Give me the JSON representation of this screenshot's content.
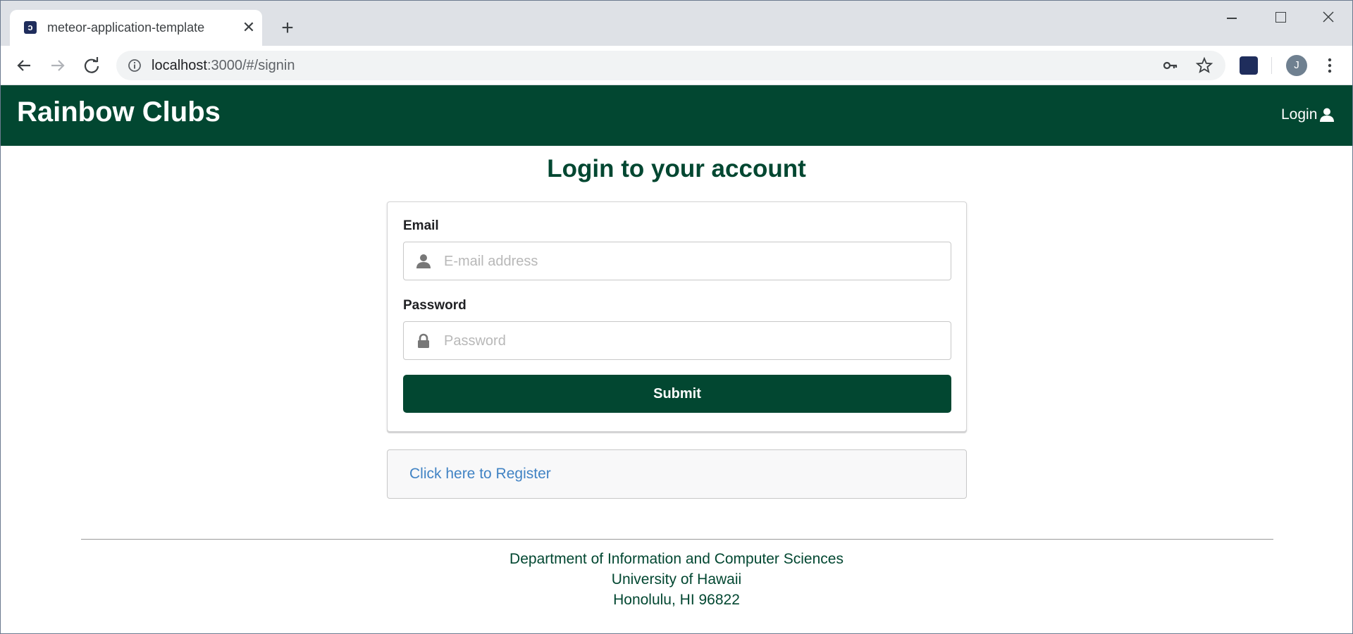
{
  "browser": {
    "tab_title": "meteor-application-template",
    "favicon_glyph": "ↄ",
    "url_host": "localhost",
    "url_rest": ":3000/#/signin",
    "profile_initial": "J"
  },
  "navbar": {
    "brand": "Rainbow Clubs",
    "login_label": "Login",
    "bg_color": "#024731"
  },
  "login": {
    "heading": "Login to your account",
    "email_label": "Email",
    "email_placeholder": "E-mail address",
    "email_value": "",
    "password_label": "Password",
    "password_placeholder": "Password",
    "password_value": "",
    "submit_label": "Submit"
  },
  "register": {
    "link_text": "Click here to Register",
    "link_color": "#4183c4"
  },
  "footer": {
    "line1": "Department of Information and Computer Sciences",
    "line2": "University of Hawaii",
    "line3": "Honolulu, HI 96822"
  }
}
